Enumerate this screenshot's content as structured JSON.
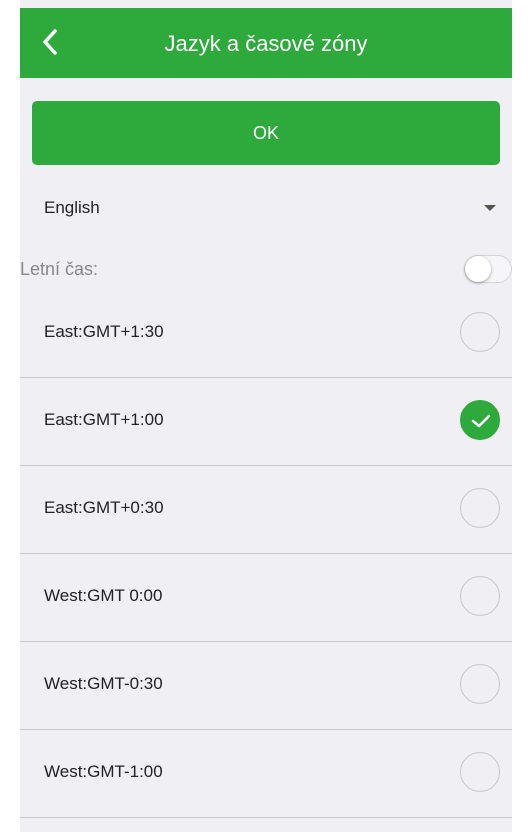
{
  "header": {
    "title": "Jazyk a časové zóny"
  },
  "ok_button": {
    "label": "OK"
  },
  "language": {
    "selected": "English"
  },
  "summer_time": {
    "label": "Letní čas:",
    "enabled": false
  },
  "timezones": [
    {
      "label": "East:GMT+1:30",
      "selected": false
    },
    {
      "label": "East:GMT+1:00",
      "selected": true
    },
    {
      "label": "East:GMT+0:30",
      "selected": false
    },
    {
      "label": "West:GMT 0:00",
      "selected": false
    },
    {
      "label": "West:GMT-0:30",
      "selected": false
    },
    {
      "label": "West:GMT-1:00",
      "selected": false
    }
  ],
  "colors": {
    "accent": "#2eaa3c",
    "background": "#efeff4"
  }
}
